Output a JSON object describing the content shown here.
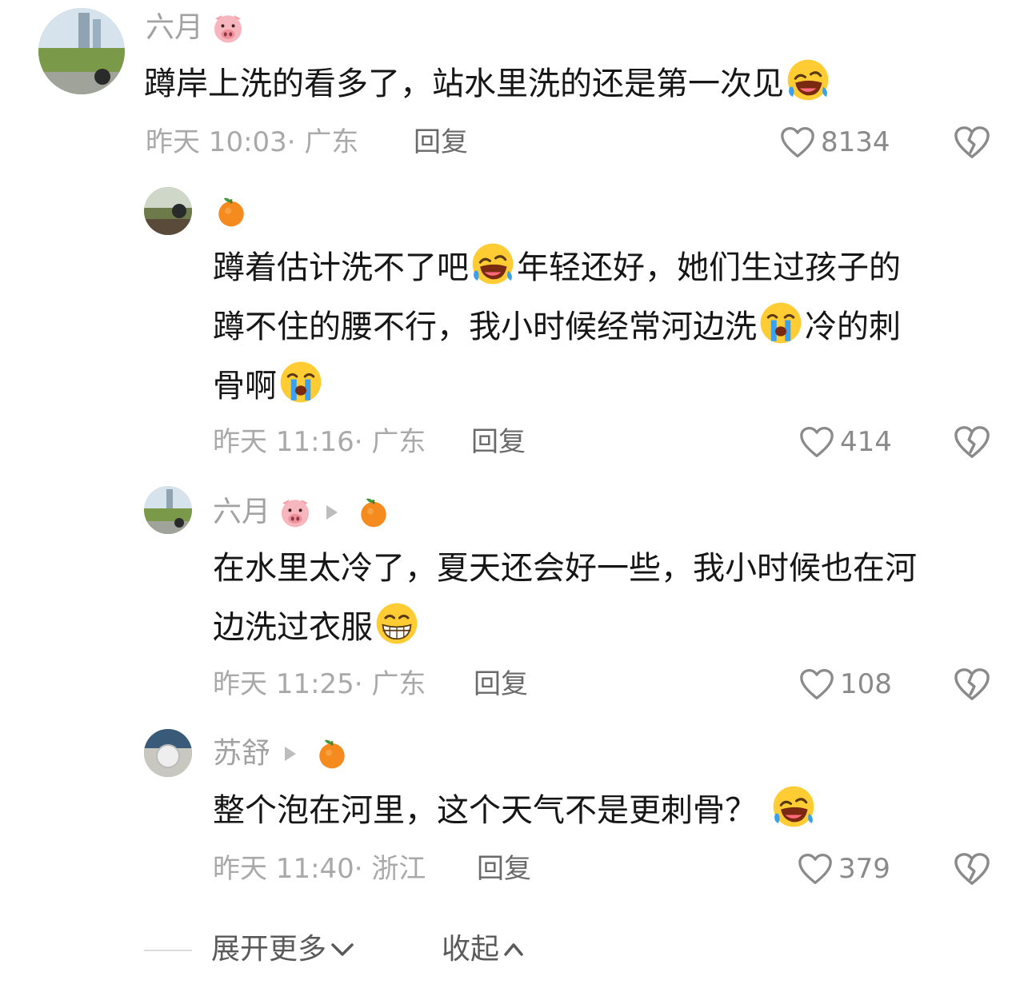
{
  "comments": [
    {
      "author": "六月",
      "author_emoji": "pig-face",
      "text_parts": [
        "蹲岸上洗的看多了，站水里洗的还是第一次见"
      ],
      "meta": "昨天 10:03· 广东",
      "reply_label": "回复",
      "likes": "8134"
    },
    {
      "author_emoji": "tangerine",
      "text_parts": [
        "蹲着估计洗不了吧",
        "年轻还好，她们生过孩子的",
        "蹲不住的腰不行，我小时候经常河边洗",
        "冷的刺",
        "骨啊"
      ],
      "meta": "昨天 11:16· 广东",
      "reply_label": "回复",
      "likes": "414"
    },
    {
      "author": "六月",
      "author_emoji": "pig-face",
      "reply_to_emoji": "tangerine",
      "text_parts": [
        "在水里太冷了，夏天还会好一些，我小时候也在河",
        "边洗过衣服"
      ],
      "meta": "昨天 11:25· 广东",
      "reply_label": "回复",
      "likes": "108"
    },
    {
      "author": "苏舒",
      "reply_to_emoji": "tangerine",
      "text_parts": [
        "整个泡在河里，这个天气不是更刺骨？"
      ],
      "meta": "昨天 11:40· 浙江",
      "reply_label": "回复",
      "likes": "379"
    }
  ],
  "footer": {
    "expand_label": "展开更多",
    "collapse_label": "收起"
  },
  "icons": {
    "like": "heart-outline-icon",
    "dislike": "broken-heart-icon",
    "expand": "chevron-down-icon",
    "collapse": "chevron-up-icon"
  },
  "colors": {
    "name": "#a2a2a2",
    "text": "#161616",
    "meta": "#a9a9a9"
  }
}
